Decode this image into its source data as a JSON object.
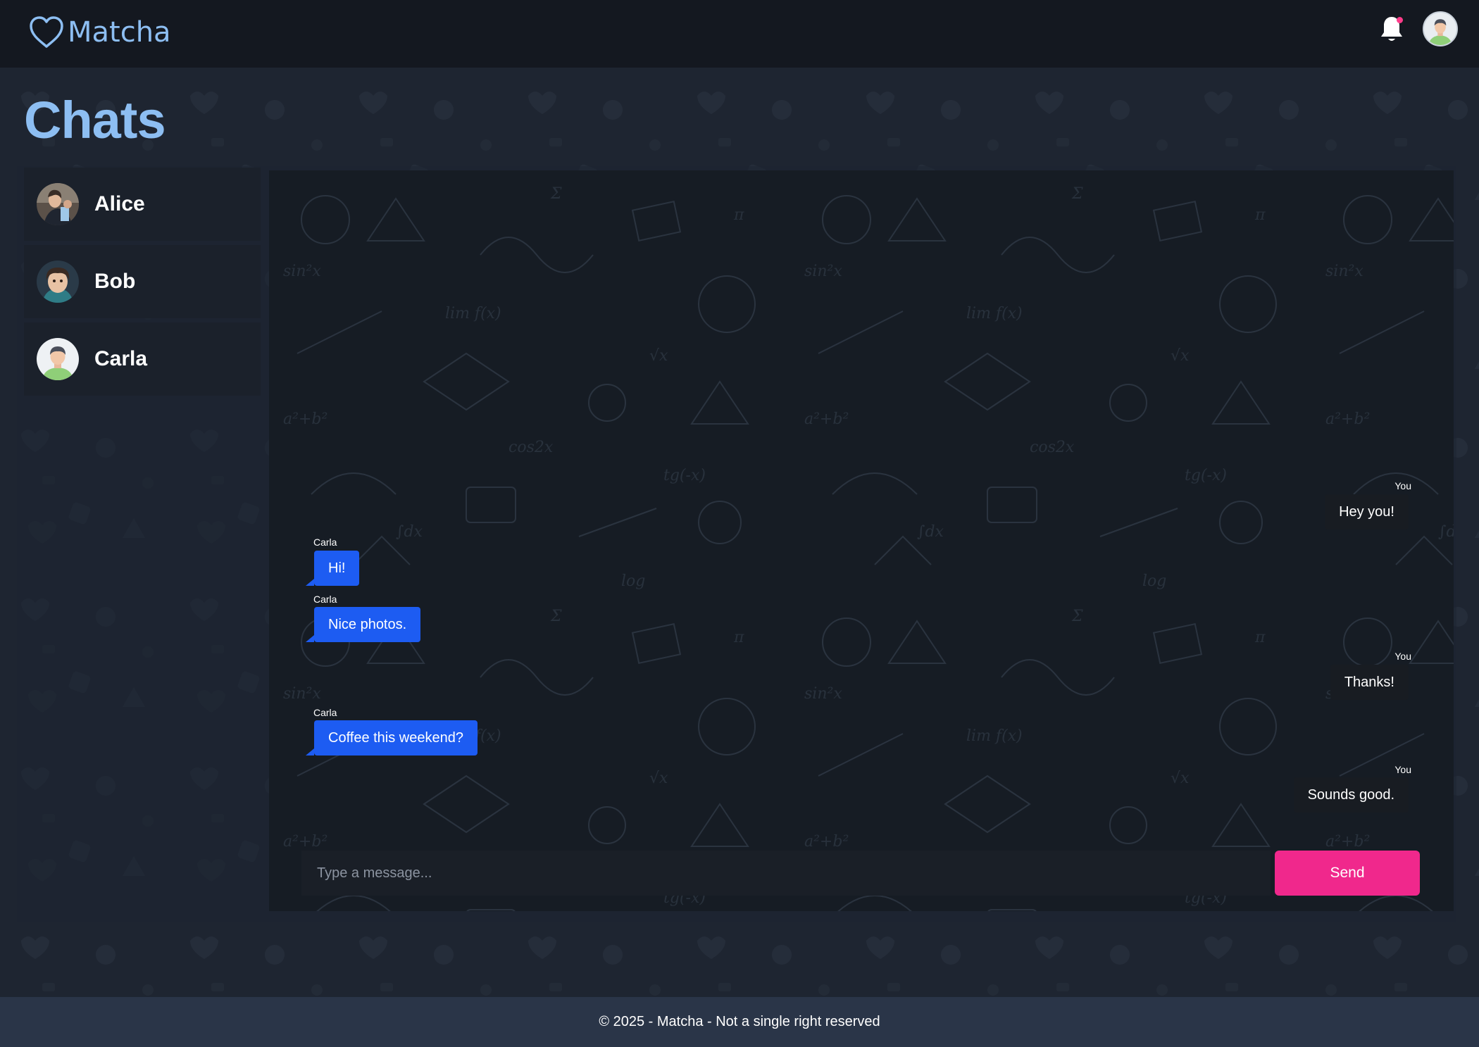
{
  "app": {
    "name": "Matcha",
    "brand_color": "#8dbef2",
    "accent_color": "#f0288c"
  },
  "navbar": {
    "logo_icon": "heart-outline-icon",
    "notification_icon": "bell-icon",
    "has_unread_notification": true,
    "user_avatar": "user-avatar"
  },
  "page": {
    "title": "Chats"
  },
  "chats": [
    {
      "name": "Alice"
    },
    {
      "name": "Bob"
    },
    {
      "name": "Carla"
    }
  ],
  "conversation": {
    "messages": [
      {
        "sender": "You",
        "text": "Hey you!",
        "direction": "outgoing"
      },
      {
        "sender": "Carla",
        "text": "Hi!",
        "direction": "incoming"
      },
      {
        "sender": "Carla",
        "text": "Nice photos.",
        "direction": "incoming"
      },
      {
        "sender": "You",
        "text": "Thanks!",
        "direction": "outgoing"
      },
      {
        "sender": "Carla",
        "text": "Coffee this weekend?",
        "direction": "incoming"
      },
      {
        "sender": "You",
        "text": "Sounds good.",
        "direction": "outgoing"
      }
    ],
    "incoming_color": "#1d5cf2",
    "outgoing_color": "#181c22"
  },
  "composer": {
    "placeholder": "Type a message...",
    "send_label": "Send"
  },
  "footer": {
    "text": "© 2025 - Matcha - Not a single right reserved"
  }
}
